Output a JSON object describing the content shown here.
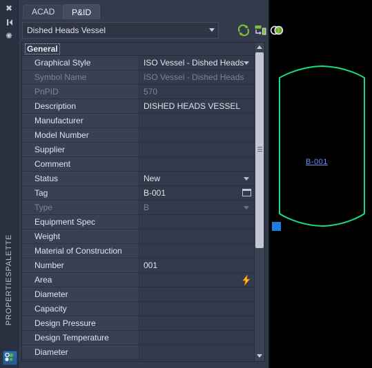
{
  "window": {
    "palette_title": "PROPERTIESPALETTE",
    "logo_icon": "autocad-pid-logo-icon"
  },
  "sidebar": {
    "icons": [
      {
        "name": "close-icon",
        "glyph": "✖"
      },
      {
        "name": "auto-hide-icon",
        "glyph": "▶|"
      },
      {
        "name": "properties-menu-icon",
        "glyph": "☸"
      }
    ]
  },
  "tabs": [
    {
      "id": "acad",
      "label": "ACAD",
      "active": false
    },
    {
      "id": "pid",
      "label": "P&ID",
      "active": true
    }
  ],
  "toolbar": {
    "object_selector_value": "Dished Heads Vessel",
    "object_selector_placeholder": "Dished Heads Vessel",
    "buttons": [
      {
        "name": "refresh-icon",
        "title": "Refresh"
      },
      {
        "name": "select-objects-icon",
        "title": "Select objects"
      },
      {
        "name": "quick-properties-icon",
        "title": "Quick select"
      }
    ]
  },
  "property_grid": {
    "category": "General",
    "rows": [
      {
        "name": "Graphical Style",
        "value": "ISO Vessel - Dished Heads",
        "control": "combo",
        "readonly": false
      },
      {
        "name": "Symbol Name",
        "value": "ISO Vessel - Dished Heads",
        "control": "text",
        "readonly": true
      },
      {
        "name": "PnPID",
        "value": "570",
        "control": "text",
        "readonly": true
      },
      {
        "name": "Description",
        "value": "DISHED HEADS VESSEL",
        "control": "text",
        "readonly": false
      },
      {
        "name": "Manufacturer",
        "value": "",
        "control": "text",
        "readonly": false
      },
      {
        "name": "Model Number",
        "value": "",
        "control": "text",
        "readonly": false
      },
      {
        "name": "Supplier",
        "value": "",
        "control": "text",
        "readonly": false
      },
      {
        "name": "Comment",
        "value": "",
        "control": "text",
        "readonly": false
      },
      {
        "name": "Status",
        "value": "New",
        "control": "combo",
        "readonly": false
      },
      {
        "name": "Tag",
        "value": "B-001",
        "control": "ellipsis",
        "readonly": false
      },
      {
        "name": "Type",
        "value": "B",
        "control": "combo",
        "readonly": true
      },
      {
        "name": "Equipment Spec",
        "value": "",
        "control": "text",
        "readonly": false
      },
      {
        "name": "Weight",
        "value": "",
        "control": "text",
        "readonly": false
      },
      {
        "name": "Material of Construction",
        "value": "",
        "control": "text",
        "readonly": false
      },
      {
        "name": "Number",
        "value": "001",
        "control": "text",
        "readonly": false
      },
      {
        "name": "Area",
        "value": "",
        "control": "bolt",
        "readonly": false
      },
      {
        "name": "Diameter",
        "value": "",
        "control": "text",
        "readonly": false
      },
      {
        "name": "Capacity",
        "value": "",
        "control": "text",
        "readonly": false
      },
      {
        "name": "Design Pressure",
        "value": "",
        "control": "text",
        "readonly": false
      },
      {
        "name": "Design Temperature",
        "value": "",
        "control": "text",
        "readonly": false
      },
      {
        "name": "Diameter",
        "value": "",
        "control": "text",
        "readonly": false
      }
    ]
  },
  "drawing": {
    "tag_label": "B-001",
    "vessel_outline_color": "#19e06a",
    "vessel_edge_color": "#15d2d2",
    "tag_color": "#6e8fff",
    "grip_color": "#1e7fe0",
    "background_color": "#000000"
  }
}
